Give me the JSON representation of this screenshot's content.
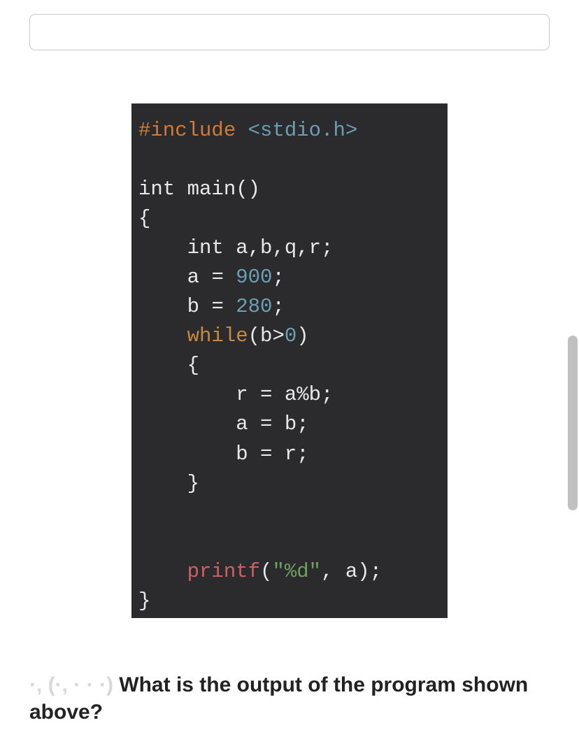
{
  "input": {
    "value": "",
    "placeholder": ""
  },
  "code": {
    "line1": {
      "preproc": "#include",
      "sp": " ",
      "header": "<stdio.h>"
    },
    "blank1": "",
    "line2": {
      "type": "int",
      "sp": " ",
      "fn": "main",
      "paren": "()"
    },
    "line3": {
      "brace": "{"
    },
    "line4": {
      "indent": "    ",
      "type": "int",
      "sp": " ",
      "vars": "a,b,q,r",
      "semi": ";"
    },
    "line5": {
      "indent": "    ",
      "lhs": "a ",
      "eq": "=",
      "sp": " ",
      "num": "900",
      "semi": ";"
    },
    "line6": {
      "indent": "    ",
      "lhs": "b ",
      "eq": "=",
      "sp": " ",
      "num": "280",
      "semi": ";"
    },
    "line7": {
      "indent": "    ",
      "kw": "while",
      "open": "(",
      "cond1": "b>",
      "zero": "0",
      "close": ")"
    },
    "line8": {
      "indent": "    ",
      "brace": "{"
    },
    "line9": {
      "indent": "        ",
      "stmt": "r = a%b;"
    },
    "line10": {
      "indent": "        ",
      "stmt": "a = b;"
    },
    "line11": {
      "indent": "        ",
      "stmt": "b = r;"
    },
    "line12": {
      "indent": "    ",
      "brace": "}"
    },
    "blank2": "",
    "blank3": "",
    "line13": {
      "indent": "    ",
      "fn": "printf",
      "open": "(",
      "str": "\"%d\"",
      "rest": ", a);"
    },
    "line14": {
      "brace": "}"
    }
  },
  "question": {
    "prefix": "·, (·, · · ·)",
    "text": " What is the output of the program shown above?"
  }
}
